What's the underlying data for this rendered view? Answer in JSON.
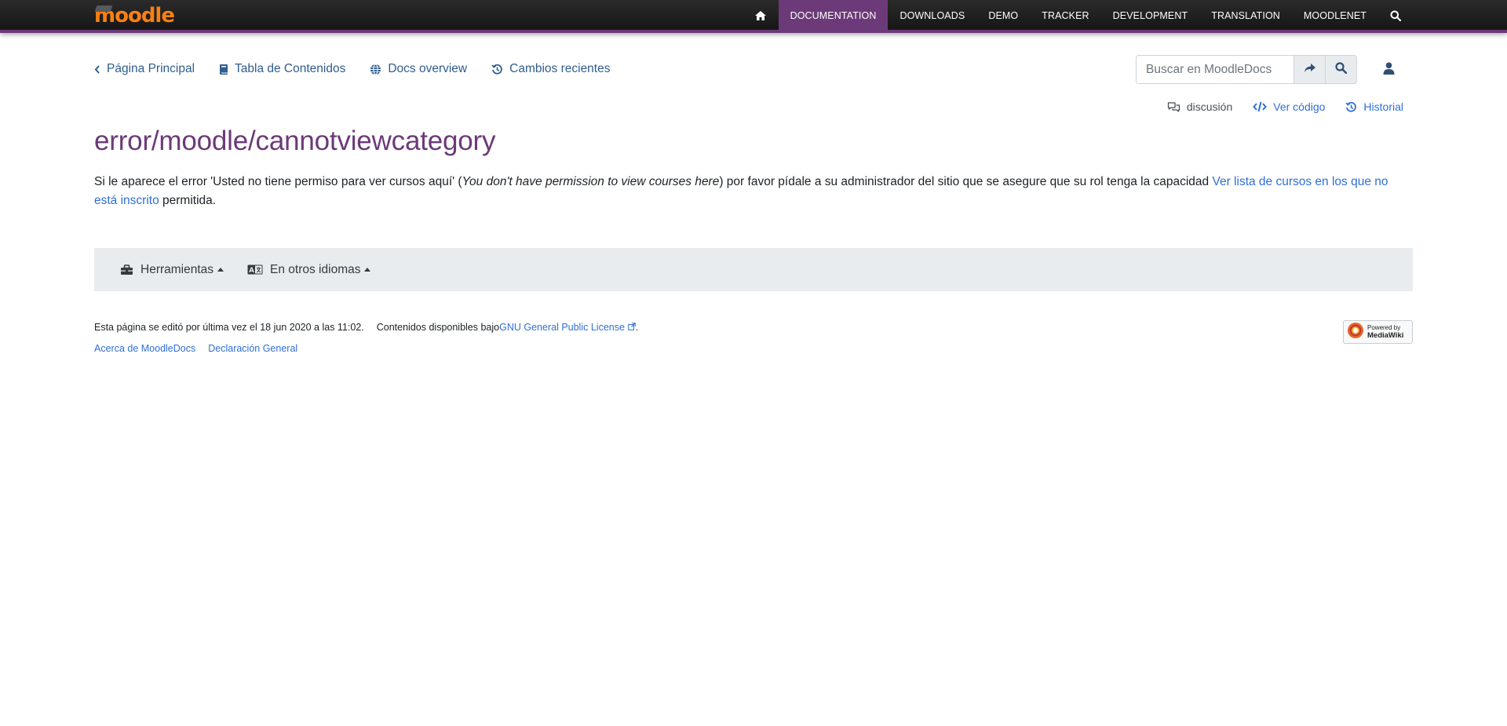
{
  "topbar": {
    "logo_text": "moodle",
    "nav": [
      {
        "label": "",
        "icon": "home-icon"
      },
      {
        "label": "DOCUMENTATION",
        "active": true
      },
      {
        "label": "DOWNLOADS"
      },
      {
        "label": "DEMO"
      },
      {
        "label": "TRACKER"
      },
      {
        "label": "DEVELOPMENT"
      },
      {
        "label": "TRANSLATION"
      },
      {
        "label": "MOODLENET"
      },
      {
        "label": "",
        "icon": "search-icon"
      }
    ]
  },
  "subnav": {
    "main_page": "Página Principal",
    "contents": "Tabla de Contenidos",
    "docs_overview": "Docs overview",
    "recent_changes": "Cambios recientes"
  },
  "search": {
    "placeholder": "Buscar en MoodleDocs"
  },
  "page_actions": {
    "discussion": "discusión",
    "view_source": "Ver código",
    "history": "Historial"
  },
  "page": {
    "title": "error/moodle/cannotviewcategory",
    "text_1": "Si le aparece el error 'Usted no tiene permiso para ver cursos aquí' (",
    "text_italic": "You don't have permission to view courses here",
    "text_2": ") por favor pídale a su administrador del sitio que se asegure que su rol tenga la capacidad ",
    "link": "Ver lista de cursos en los que no está inscrito",
    "text_3": " permitida."
  },
  "toolbar": {
    "tools": "Herramientas",
    "languages": "En otros idiomas"
  },
  "footer": {
    "last_edited": "Esta página se editó por última vez el 18 jun 2020 a las 11:02.",
    "license_prefix": "Contenidos disponibles bajo ",
    "license_link": "GNU General Public License",
    "license_suffix": ".",
    "about": "Acerca de MoodleDocs",
    "disclaimer": "Declaración General",
    "powered_line1": "Powered by",
    "powered_line2": "MediaWiki"
  },
  "colors": {
    "brand_purple": "#6c3a78",
    "link_blue": "#2f6fd6",
    "logo_orange": "#f98012"
  }
}
